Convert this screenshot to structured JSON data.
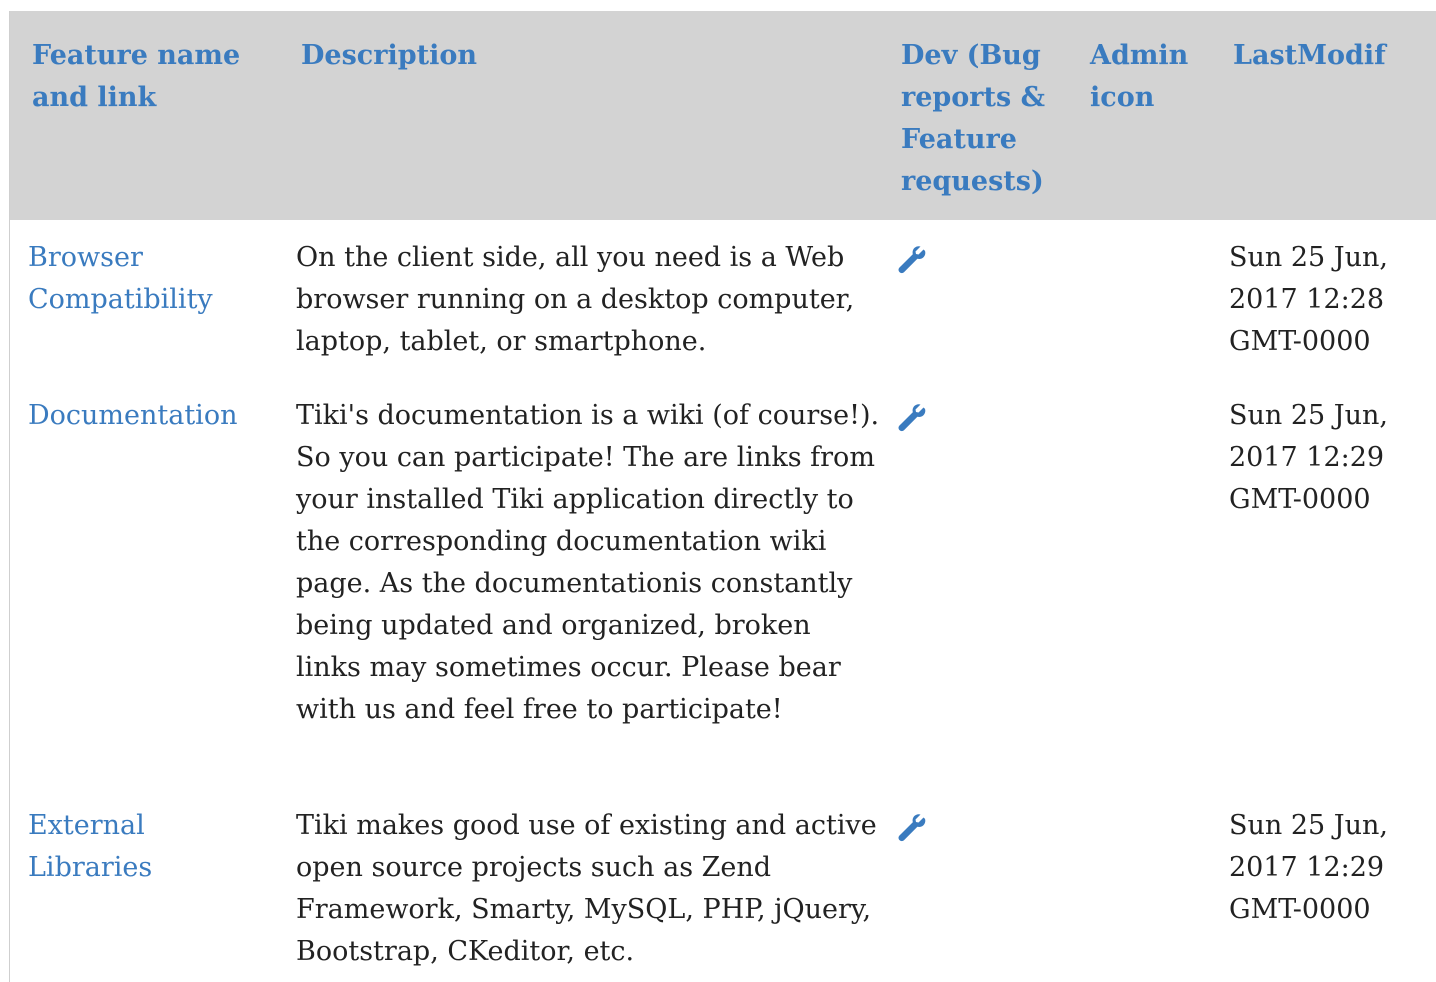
{
  "table": {
    "headers": {
      "feature": "Feature name and link",
      "description": "Description",
      "dev": "Dev (Bug reports & Feature requests)",
      "admin": "Admin icon",
      "lastmodif": "LastModif"
    },
    "rows": [
      {
        "feature": "Browser Compatibility",
        "description": "On the client side, all you need is a Web browser running on a desktop computer, laptop, tablet, or smartphone.",
        "dev_icon": "wrench-icon",
        "lastmodif": "Sun 25 Jun, 2017 12:28 GMT-0000"
      },
      {
        "feature": "Documentation",
        "description": "Tiki's documentation is a wiki (of course!). So you can participate! The are links from your installed Tiki application directly to the corresponding documentation wiki page. As the documentationis constantly being updated and organized, broken links may sometimes occur. Please bear with us and feel free to participate!",
        "dev_icon": "wrench-icon",
        "lastmodif": "Sun 25 Jun, 2017 12:29 GMT-0000"
      },
      {
        "feature": "External Libraries",
        "description": "Tiki makes good use of existing and active open source projects such as Zend Framework, Smarty, MySQL, PHP, jQuery, Bootstrap, CKeditor, etc.",
        "dev_icon": "wrench-icon",
        "lastmodif": "Sun 25 Jun, 2017 12:29 GMT-0000"
      }
    ]
  },
  "colors": {
    "link": "#3a7bbf",
    "header_bg": "#d3d3d3",
    "text": "#222222"
  }
}
